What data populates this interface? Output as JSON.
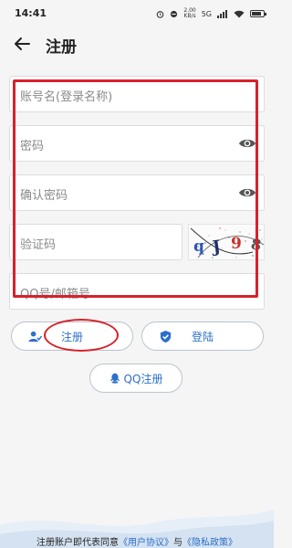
{
  "status_bar": {
    "time": "14:41",
    "net_speed": "2.00",
    "net_unit": "KB/s",
    "signal_label": "5G"
  },
  "header": {
    "title": "注册"
  },
  "form": {
    "account_placeholder": "账号名(登录名称)",
    "password_placeholder": "密码",
    "confirm_placeholder": "确认密码",
    "captcha_placeholder": "验证码",
    "contact_placeholder": "QQ号/邮箱号",
    "captcha_text": [
      "q",
      "J",
      "9",
      "8"
    ]
  },
  "actions": {
    "register_label": "注册",
    "login_label": "登陆",
    "qq_register_label": "QQ注册"
  },
  "footer": {
    "prefix": "注册账户即代表同意",
    "user_agreement": "《用户协议》",
    "connector": "与",
    "privacy_policy": "《隐私政策》"
  },
  "colors": {
    "accent": "#2d6fc9",
    "annotation": "#d6222c",
    "background": "#f5f5f5"
  }
}
